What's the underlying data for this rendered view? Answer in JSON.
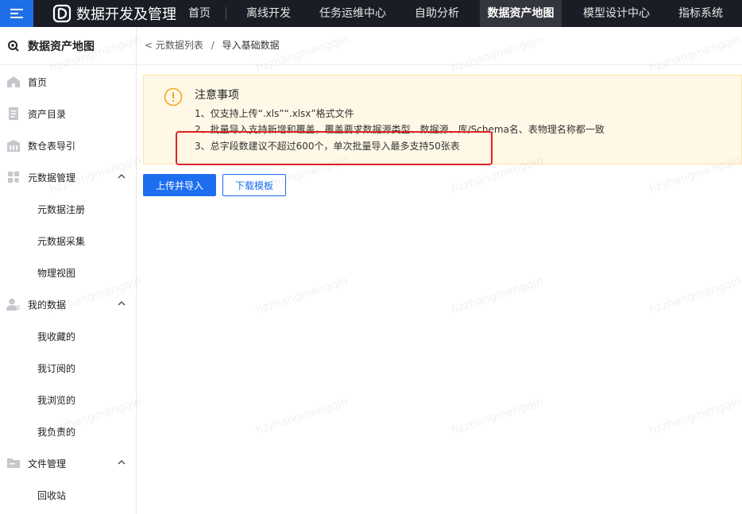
{
  "header": {
    "app_title": "数据开发及管理",
    "nav": [
      {
        "label": "首页"
      },
      {
        "label": "离线开发"
      },
      {
        "label": "任务运维中心"
      },
      {
        "label": "自助分析"
      },
      {
        "label": "数据资产地图",
        "active": true
      },
      {
        "label": "模型设计中心"
      },
      {
        "label": "指标系统"
      }
    ]
  },
  "sidebar": {
    "title": "数据资产地图",
    "items": [
      {
        "label": "首页",
        "icon": "home-icon"
      },
      {
        "label": "资产目录",
        "icon": "catalog-icon"
      },
      {
        "label": "数仓表导引",
        "icon": "warehouse-icon"
      },
      {
        "label": "元数据管理",
        "icon": "grid-icon",
        "expanded": true
      },
      {
        "label": "元数据注册"
      },
      {
        "label": "元数据采集"
      },
      {
        "label": "物理视图"
      },
      {
        "label": "我的数据",
        "icon": "user-icon",
        "expanded": true
      },
      {
        "label": "我收藏的"
      },
      {
        "label": "我订阅的"
      },
      {
        "label": "我浏览的"
      },
      {
        "label": "我负责的"
      },
      {
        "label": "文件管理",
        "icon": "folder-icon",
        "expanded": true
      },
      {
        "label": "回收站"
      }
    ]
  },
  "breadcrumb": {
    "back": "<",
    "parent": "元数据列表",
    "separator": "/",
    "current": "导入基础数据"
  },
  "notice": {
    "title": "注意事项",
    "lines": [
      "1、仅支持上传“.xls”“.xlsx”格式文件",
      "2、批量导入支持新增和覆盖，覆盖要求数据源类型、数据源、库/Schema名、表物理名称都一致",
      "3、总字段数建议不超过600个，单次批量导入最多支持50张表"
    ]
  },
  "actions": {
    "upload": "上传并导入",
    "download": "下载模板"
  },
  "watermark": "hzzhangmengqin",
  "colors": {
    "topbar": "#1b1d26",
    "accent": "#1e6ff0",
    "notice_bg": "#fff8e6",
    "highlight": "#e02323"
  }
}
